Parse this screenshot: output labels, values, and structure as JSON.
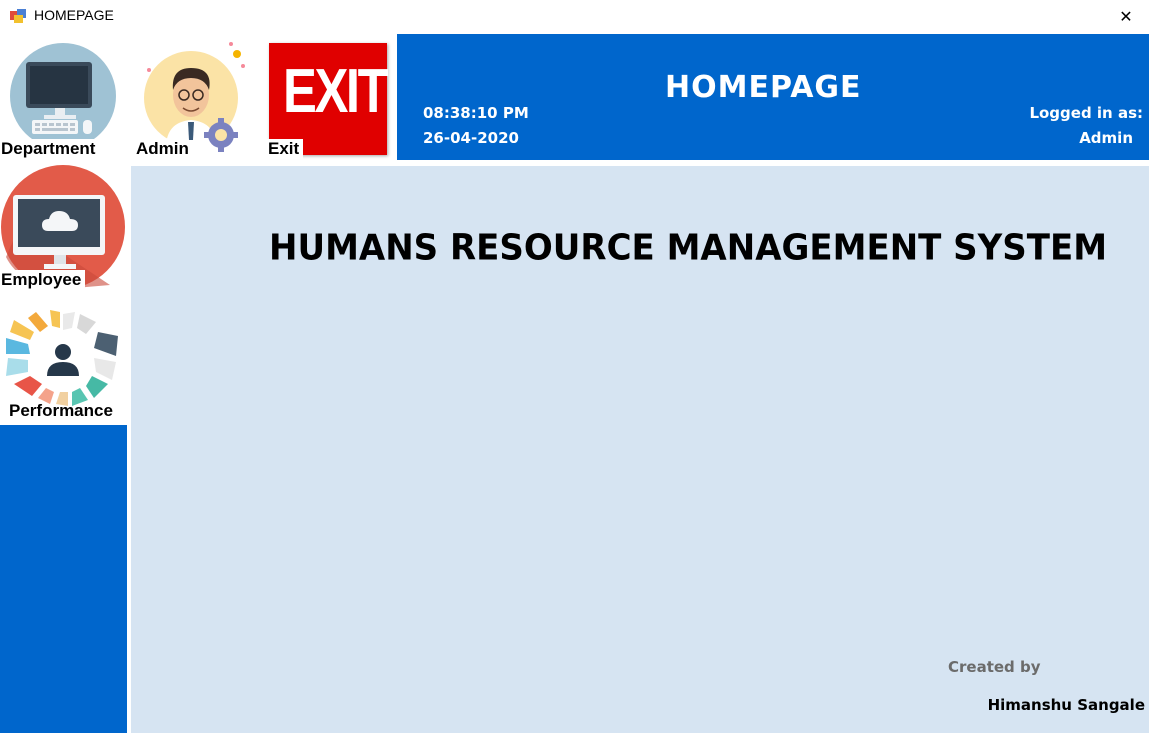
{
  "window": {
    "title": "HOMEPAGE",
    "close_glyph": "✕"
  },
  "sidebar": {
    "items": [
      {
        "label": "Department",
        "icon": "desktop-computer-icon"
      },
      {
        "label": "Employee",
        "icon": "cloud-monitor-icon"
      },
      {
        "label": "Performance",
        "icon": "performance-gauge-icon"
      }
    ]
  },
  "toolbar": {
    "admin_label": "Admin",
    "admin_icon": "admin-avatar-icon",
    "exit_label": "Exit",
    "exit_sign_text": "EXIT"
  },
  "header": {
    "title": "HOMEPAGE",
    "time": "08:38:10 PM",
    "date": "26-04-2020",
    "logged_in_label": "Logged in as:",
    "logged_in_user": "Admin"
  },
  "main": {
    "title": "HUMANS RESOURCE MANAGEMENT SYSTEM",
    "created_by_label": "Created by",
    "author": "Himanshu Sangale"
  },
  "colors": {
    "header_blue": "#0066cc",
    "main_bg": "#d6e4f2",
    "exit_red": "#e00000"
  }
}
